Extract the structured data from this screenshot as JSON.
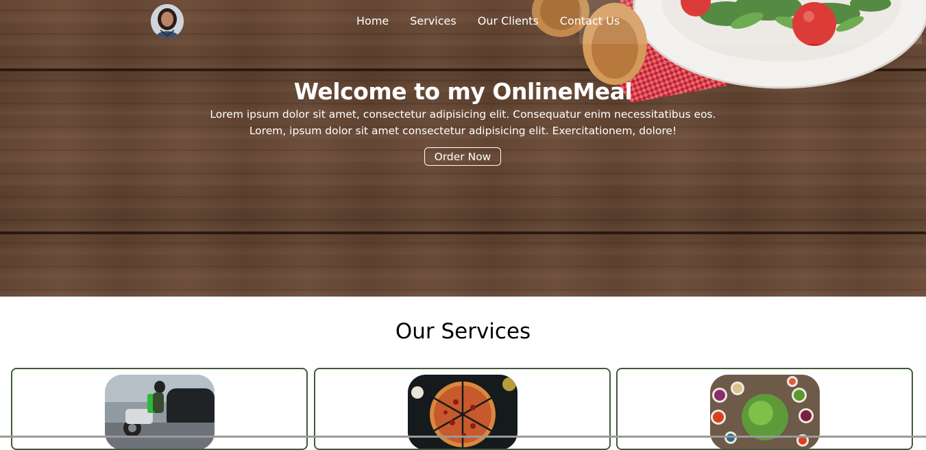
{
  "nav": {
    "items": [
      {
        "label": "Home"
      },
      {
        "label": "Services"
      },
      {
        "label": "Our Clients"
      },
      {
        "label": "Contact Us"
      }
    ]
  },
  "hero": {
    "title": "Welcome to my OnlineMeal",
    "line1": "Lorem ipsum dolor sit amet, consectetur adipisicing elit. Consequatur enim necessitatibus eos.",
    "line2": "Lorem, ipsum dolor sit amet consectetur adipisicing elit. Exercitationem, dolore!",
    "button_label": "Order Now"
  },
  "services": {
    "title": "Our Services",
    "cards": [
      {
        "image": "delivery-scooter-image"
      },
      {
        "image": "pizza-image"
      },
      {
        "image": "salad-bowls-image"
      }
    ]
  },
  "colors": {
    "wood": "#5c3f2d",
    "card_border": "#3f5a3a",
    "text_light": "#ffffff"
  }
}
